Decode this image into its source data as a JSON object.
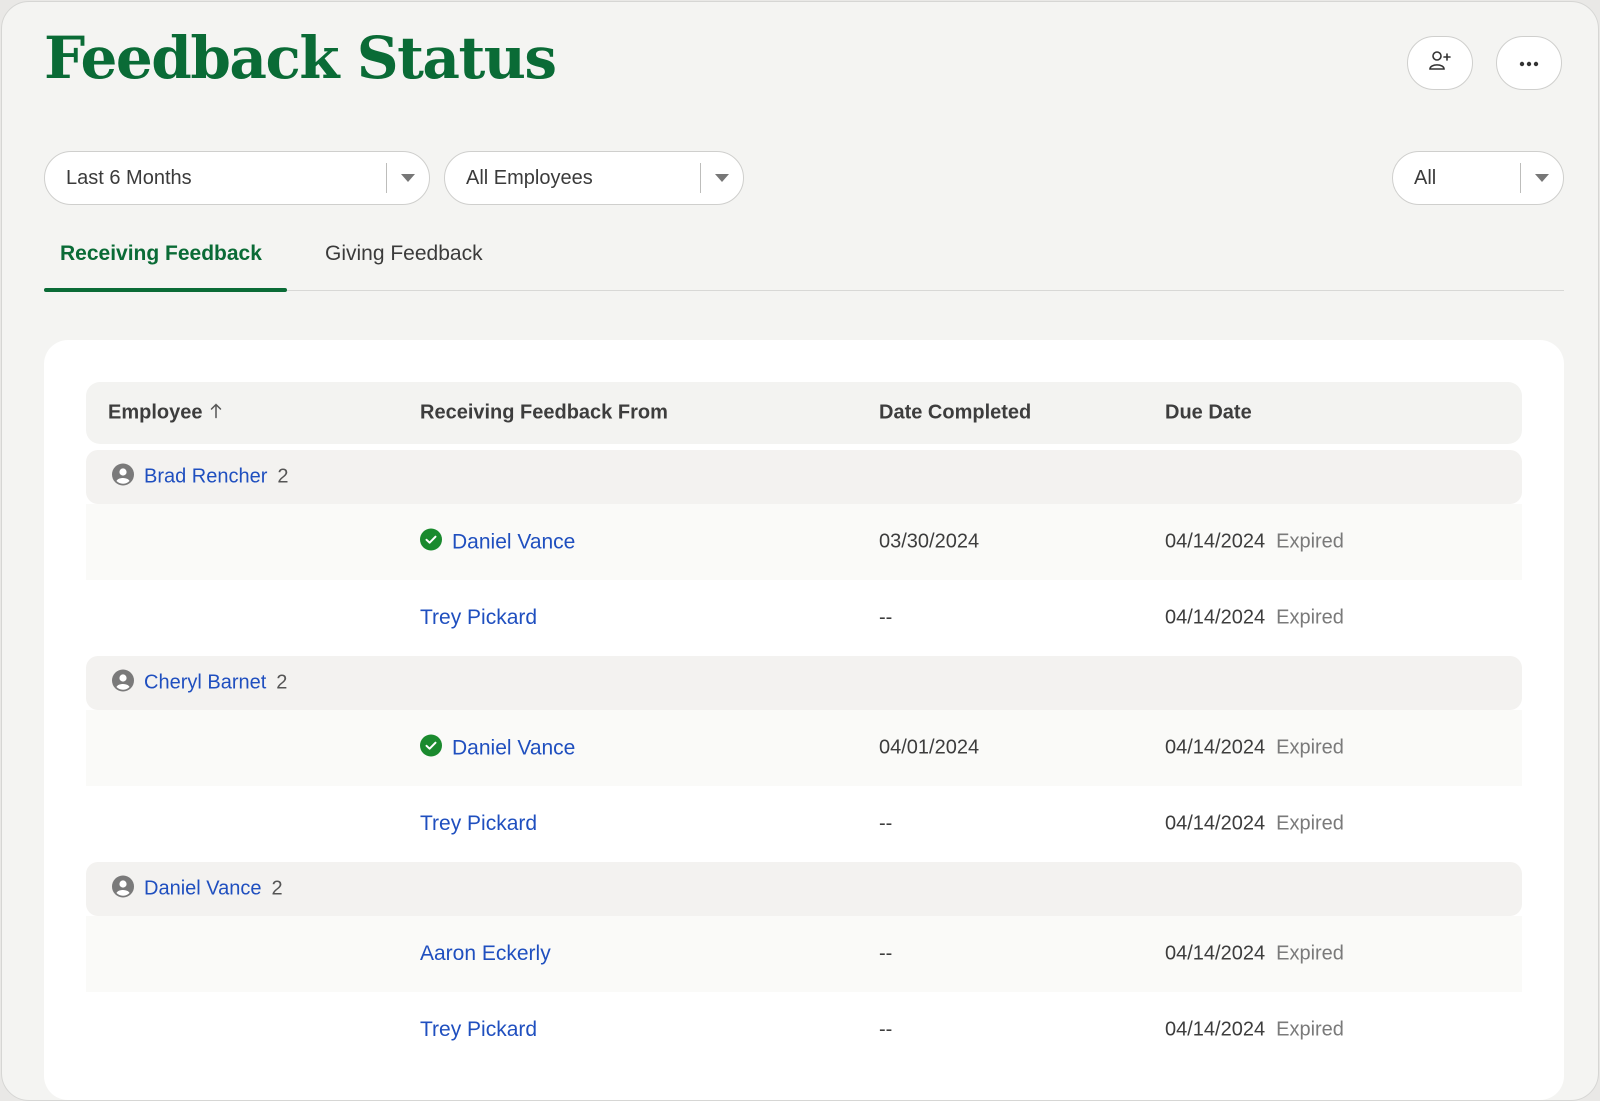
{
  "header": {
    "title": "Feedback Status",
    "add_button_icon": "user-plus-icon",
    "more_button_icon": "more-horizontal-icon"
  },
  "filters": {
    "period": "Last 6 Months",
    "employees": "All Employees",
    "status": "All"
  },
  "tabs": [
    {
      "label": "Receiving Feedback",
      "active": true
    },
    {
      "label": "Giving Feedback",
      "active": false
    }
  ],
  "table": {
    "columns": [
      "Employee",
      "Receiving Feedback From",
      "Date Completed",
      "Due Date"
    ],
    "sort": {
      "column": "Employee",
      "direction": "ascending"
    },
    "groups": [
      {
        "employee": "Brad Rencher",
        "count": "2",
        "rows": [
          {
            "from": "Daniel Vance",
            "completed": true,
            "date_completed": "03/30/2024",
            "due_date": "04/14/2024",
            "status": "Expired"
          },
          {
            "from": "Trey Pickard",
            "completed": false,
            "date_completed": "--",
            "due_date": "04/14/2024",
            "status": "Expired"
          }
        ]
      },
      {
        "employee": "Cheryl Barnet",
        "count": "2",
        "rows": [
          {
            "from": "Daniel Vance",
            "completed": true,
            "date_completed": "04/01/2024",
            "due_date": "04/14/2024",
            "status": "Expired"
          },
          {
            "from": "Trey Pickard",
            "completed": false,
            "date_completed": "--",
            "due_date": "04/14/2024",
            "status": "Expired"
          }
        ]
      },
      {
        "employee": "Daniel Vance",
        "count": "2",
        "rows": [
          {
            "from": "Aaron Eckerly",
            "completed": false,
            "date_completed": "--",
            "due_date": "04/14/2024",
            "status": "Expired"
          },
          {
            "from": "Trey Pickard",
            "completed": false,
            "date_completed": "--",
            "due_date": "04/14/2024",
            "status": "Expired"
          }
        ]
      }
    ]
  },
  "colors": {
    "brand_green": "#0a6b36",
    "link_blue": "#1f4fbf",
    "check_green": "#1a8a2e",
    "background": "#f4f4f2"
  }
}
